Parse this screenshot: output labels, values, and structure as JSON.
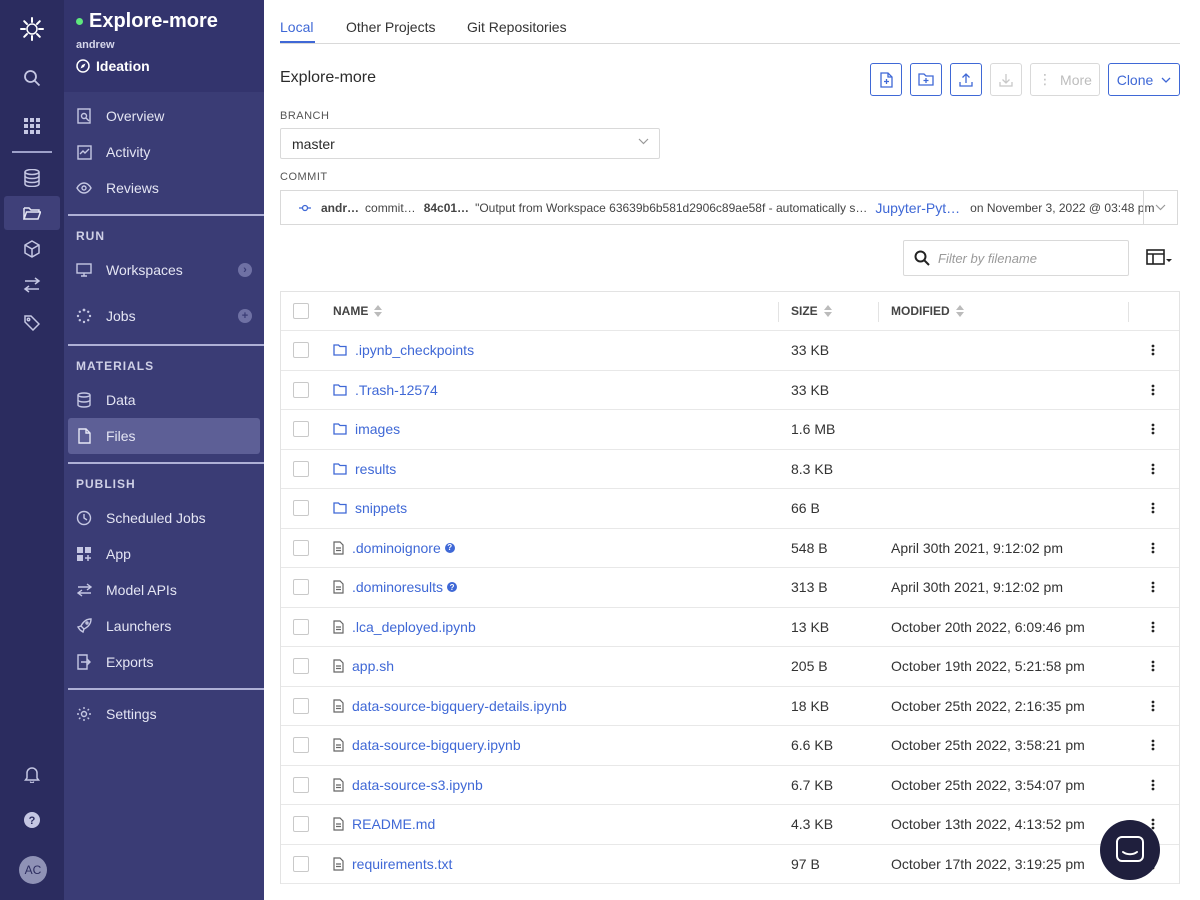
{
  "rail": {
    "avatar_initials": "AC"
  },
  "project": {
    "name": "Explore-more",
    "owner": "andrew",
    "stage": "Ideation"
  },
  "nav": {
    "overview": "Overview",
    "activity": "Activity",
    "reviews": "Reviews",
    "run_heading": "RUN",
    "workspaces": "Workspaces",
    "jobs": "Jobs",
    "materials_heading": "MATERIALS",
    "data": "Data",
    "files": "Files",
    "publish_heading": "PUBLISH",
    "scheduled_jobs": "Scheduled Jobs",
    "app": "App",
    "model_apis": "Model APIs",
    "launchers": "Launchers",
    "exports": "Exports",
    "settings": "Settings"
  },
  "tabs": [
    "Local",
    "Other Projects",
    "Git Repositories"
  ],
  "toolbar": {
    "title": "Explore-more",
    "more_label": "More",
    "clone_label": "Clone"
  },
  "branch": {
    "label": "BRANCH",
    "value": "master"
  },
  "commit": {
    "label": "COMMIT",
    "author": "andr…",
    "action": "commit…",
    "hash": "84c01…",
    "message": "\"Output from Workspace 63639b6b581d2906c89ae58f - automatically s…",
    "source": "Jupyter-Pyt…",
    "date": "on November 3, 2022 @ 03:48 pm"
  },
  "filter": {
    "placeholder": "Filter by filename"
  },
  "table": {
    "headers": {
      "name": "NAME",
      "size": "SIZE",
      "modified": "MODIFIED"
    },
    "rows": [
      {
        "type": "folder",
        "name": ".ipynb_checkpoints",
        "size": "33 KB",
        "modified": ""
      },
      {
        "type": "folder",
        "name": ".Trash-12574",
        "size": "33 KB",
        "modified": ""
      },
      {
        "type": "folder",
        "name": "images",
        "size": "1.6 MB",
        "modified": ""
      },
      {
        "type": "folder",
        "name": "results",
        "size": "8.3 KB",
        "modified": ""
      },
      {
        "type": "folder",
        "name": "snippets",
        "size": "66 B",
        "modified": ""
      },
      {
        "type": "file",
        "name": ".dominoignore",
        "help": true,
        "size": "548 B",
        "modified": "April 30th 2021, 9:12:02 pm"
      },
      {
        "type": "file",
        "name": ".dominoresults",
        "help": true,
        "size": "313 B",
        "modified": "April 30th 2021, 9:12:02 pm"
      },
      {
        "type": "file",
        "name": ".lca_deployed.ipynb",
        "size": "13 KB",
        "modified": "October 20th 2022, 6:09:46 pm"
      },
      {
        "type": "file",
        "name": "app.sh",
        "size": "205 B",
        "modified": "October 19th 2022, 5:21:58 pm"
      },
      {
        "type": "file",
        "name": "data-source-bigquery-details.ipynb",
        "size": "18 KB",
        "modified": "October 25th 2022, 2:16:35 pm"
      },
      {
        "type": "file",
        "name": "data-source-bigquery.ipynb",
        "size": "6.6 KB",
        "modified": "October 25th 2022, 3:58:21 pm"
      },
      {
        "type": "file",
        "name": "data-source-s3.ipynb",
        "size": "6.7 KB",
        "modified": "October 25th 2022, 3:54:07 pm"
      },
      {
        "type": "file",
        "name": "README.md",
        "size": "4.3 KB",
        "modified": "October 13th 2022, 4:13:52 pm"
      },
      {
        "type": "file",
        "name": "requirements.txt",
        "size": "97 B",
        "modified": "October 17th 2022, 3:19:25 pm"
      }
    ]
  },
  "colors": {
    "rail": "#2b2c5f",
    "sidebar": "#3a3c75",
    "accent": "#3f68d6",
    "status_dot": "#5ee87d"
  }
}
